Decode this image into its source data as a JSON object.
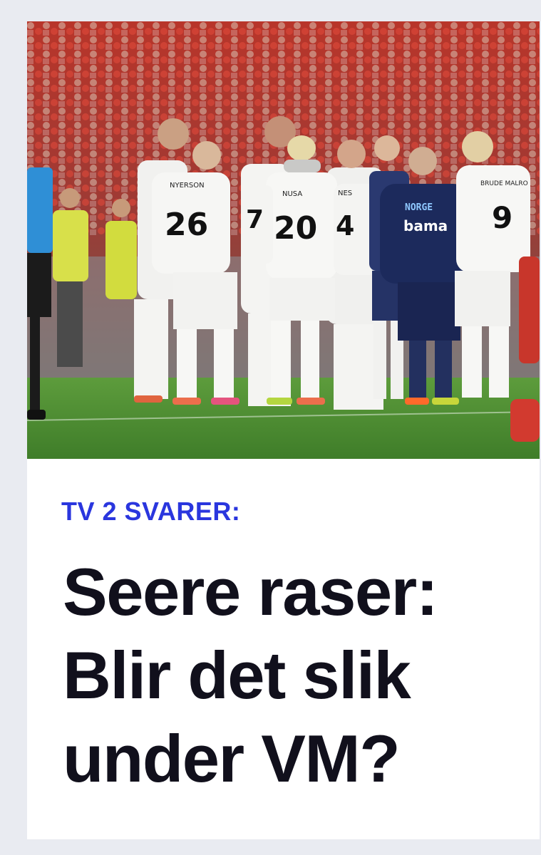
{
  "article": {
    "image_alt": "",
    "jersey_names": [
      "NYERSON",
      "NUSA",
      "NES",
      "BRUDE MALRO"
    ],
    "jersey_numbers": [
      "26",
      "20",
      "4",
      "7",
      "9"
    ],
    "sponsor": {
      "crest": "NORGE",
      "brand": "bama"
    },
    "kicker": "TV 2 SVARER:",
    "kicker_color": "#2a36de",
    "headline_lines": [
      "Seere raser:",
      "Blir det slik",
      "under VM?"
    ]
  },
  "colors": {
    "background": "#e9ebf1",
    "card": "#ffffff",
    "headline": "#11101c",
    "pitch": "#4f8f33",
    "crowd": "#c8402f",
    "coach_kit": "#1c2a5c"
  }
}
